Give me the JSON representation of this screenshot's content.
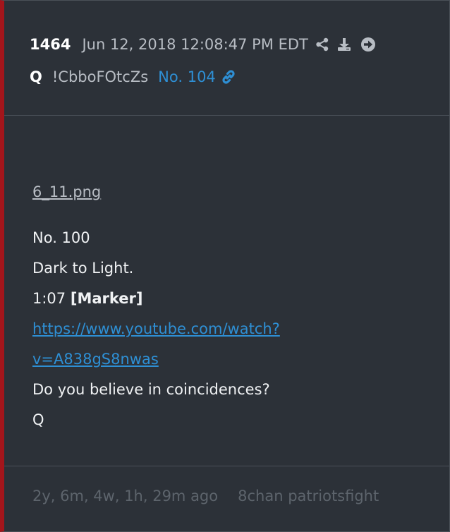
{
  "post": {
    "number": "1464",
    "date": "Jun 12, 2018 12:08:47 PM EDT",
    "author": "Q",
    "tripcode": "!CbboFOtcZs",
    "reference": "No. 104",
    "icons": [
      "share-icon",
      "download-icon",
      "arrow-right-circle-icon",
      "link-icon"
    ]
  },
  "body": {
    "file_name": "6_11.png",
    "lines": [
      "No. 100",
      "Dark to Light.",
      "1:07 ",
      "Do you believe in coincidences?",
      "Q"
    ],
    "marker": "[Marker]",
    "url_line1": "https://www.youtube.com/watch?",
    "url_line2": "v=A838gS8nwas"
  },
  "footer": {
    "age": "2y, 6m, 4w, 1h, 29m ago",
    "source": "8chan patriotsfight"
  },
  "colors": {
    "accent_bar": "#a3151b",
    "link": "#2e8fd4",
    "background": "#2c3138"
  }
}
